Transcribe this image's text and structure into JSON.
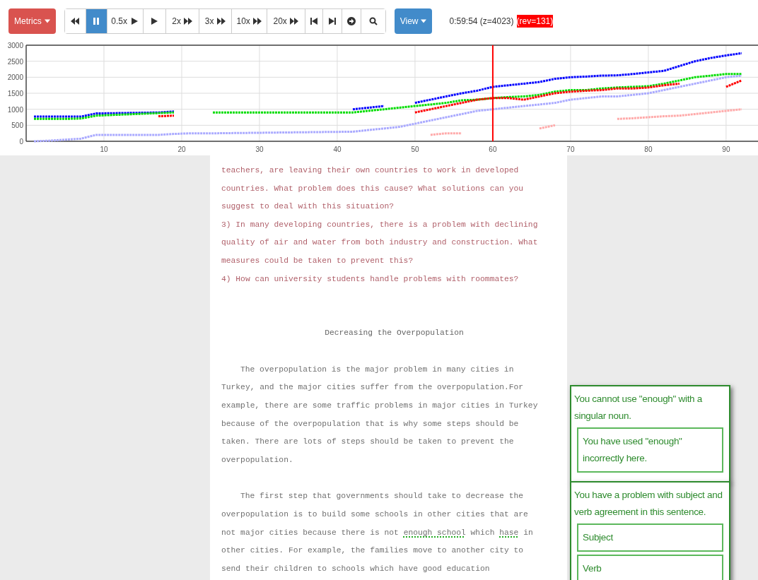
{
  "toolbar": {
    "metrics_button": "Metrics",
    "playback_buttons": [
      {
        "kind": "rewind",
        "selected": false
      },
      {
        "kind": "pause",
        "selected": true
      },
      {
        "label": "0.5x",
        "kind": "play",
        "selected": false
      },
      {
        "kind": "play",
        "selected": false
      },
      {
        "label": "2x",
        "kind": "fast",
        "selected": false
      },
      {
        "label": "3x",
        "kind": "fast",
        "selected": false
      },
      {
        "label": "10x",
        "kind": "fast",
        "selected": false
      },
      {
        "label": "20x",
        "kind": "fast",
        "selected": false
      },
      {
        "kind": "stepback",
        "selected": false
      },
      {
        "kind": "stepforward",
        "selected": false
      },
      {
        "kind": "go",
        "selected": false
      },
      {
        "kind": "search",
        "selected": false
      }
    ],
    "view_button": "View",
    "status": "0:59:54 (z=4023)",
    "revision": "(rev=131)"
  },
  "chart_data": {
    "type": "line",
    "grid": true,
    "xlim": [
      0,
      94.1
    ],
    "ylim": [
      0,
      3000
    ],
    "xticks": [
      10,
      20,
      30,
      40,
      50,
      60,
      70,
      80,
      90
    ],
    "yticks": [
      0,
      500,
      1000,
      1500,
      2000,
      2500,
      3000
    ],
    "x": [
      1,
      3,
      5,
      7,
      9,
      17,
      19,
      21,
      24,
      42,
      44,
      46,
      48,
      50,
      52,
      54,
      56,
      58,
      60,
      62,
      64,
      66,
      68,
      70,
      72,
      74,
      76,
      78,
      80,
      82,
      84,
      86,
      88,
      90,
      92
    ],
    "series": [
      {
        "color": "#0000ff",
        "line_style": "dashed",
        "values": [
          770,
          770,
          770,
          770,
          870,
          900,
          930,
          null,
          null,
          1000,
          1050,
          1100,
          null,
          1200,
          1300,
          1400,
          1500,
          1580,
          1700,
          1750,
          1800,
          1850,
          1950,
          2000,
          2020,
          2050,
          2060,
          2100,
          2150,
          2200,
          2350,
          2500,
          2600,
          2680,
          2750
        ]
      },
      {
        "color": "#00dd00",
        "line_style": "dashed",
        "values": [
          700,
          700,
          700,
          710,
          800,
          880,
          900,
          null,
          900,
          900,
          950,
          1000,
          1050,
          1100,
          1150,
          1200,
          1280,
          1300,
          1350,
          1380,
          1400,
          1450,
          1550,
          1600,
          1600,
          1650,
          1680,
          1700,
          1720,
          1800,
          1900,
          2000,
          2050,
          2100,
          2100
        ]
      },
      {
        "color": "#aaaaff",
        "line_style": "dashed",
        "values": [
          0,
          20,
          50,
          80,
          200,
          200,
          230,
          250,
          250,
          300,
          350,
          400,
          450,
          550,
          650,
          750,
          850,
          950,
          1000,
          1050,
          1100,
          1150,
          1200,
          1300,
          1350,
          1400,
          1400,
          1450,
          1500,
          1600,
          1700,
          1800,
          1900,
          2000,
          2050
        ]
      },
      {
        "color": "#ff0000",
        "line_style": "dashed",
        "values": [
          null,
          null,
          null,
          null,
          null,
          780,
          800,
          null,
          null,
          null,
          null,
          null,
          null,
          900,
          1000,
          1100,
          1200,
          1300,
          1350,
          1350,
          1300,
          1400,
          1500,
          1550,
          1580,
          1600,
          1650,
          1650,
          1680,
          1750,
          1800,
          null,
          null,
          1700,
          1900
        ]
      },
      {
        "color": "#ffaaaa",
        "line_style": "dashed",
        "values": [
          null,
          null,
          null,
          null,
          null,
          null,
          null,
          null,
          null,
          null,
          null,
          null,
          null,
          null,
          200,
          250,
          250,
          null,
          null,
          null,
          null,
          400,
          500,
          null,
          null,
          null,
          700,
          720,
          750,
          780,
          800,
          850,
          900,
          950,
          1000
        ]
      }
    ],
    "ref_lines": [
      {
        "axis": "x",
        "value": 60
      }
    ]
  },
  "document": {
    "paragraphs": [
      {
        "kind": "prompt",
        "lines": [
          "teachers, are leaving their own countries to work in developed",
          "countries. What problem does this cause? What solutions can you",
          "suggest to deal with this situation?",
          "3) In many developing countries, there is a problem with declining",
          "quality of air and water from both industry and construction. What",
          "measures could be taken to prevent this?",
          "4) How can university students handle problems with roommates?"
        ]
      },
      {
        "kind": "heading",
        "lines": [
          "Decreasing the Overpopulation"
        ]
      },
      {
        "kind": "essay",
        "lines": [
          "The overpopulation is the major problem in many cities in",
          "Turkey, and the major cities suffer from the overpopulation.For",
          "example, there are some traffic problems in major cities in Turkey",
          "because of the overpopulation that is why some steps should be",
          "taken. There are lots of steps should be taken to prevent the",
          "overpopulation."
        ]
      },
      {
        "kind": "essay",
        "lines": [
          "The first step that governments should take to decrease the",
          "overpopulation is to build some schools in other cities that are",
          [
            {
              "text": "not major cities because there is not ",
              "flagged": false
            },
            {
              "text": "enough school",
              "flagged": true
            },
            {
              "text": " which ",
              "flagged": false
            },
            {
              "text": "hase",
              "flagged": true
            },
            {
              "text": " in",
              "flagged": false
            }
          ],
          "other cities. For example, the families move to another city to",
          "send their children to schools which have good education"
        ]
      }
    ]
  },
  "feedback": [
    {
      "message": "You cannot use \"enough\" with a singular noun.",
      "options": [
        "You have used \"enough\" incorrectly here."
      ]
    },
    {
      "message": "You have a problem with subject and verb agreement in this sentence.",
      "options": [
        "Subject",
        "Verb"
      ]
    }
  ]
}
